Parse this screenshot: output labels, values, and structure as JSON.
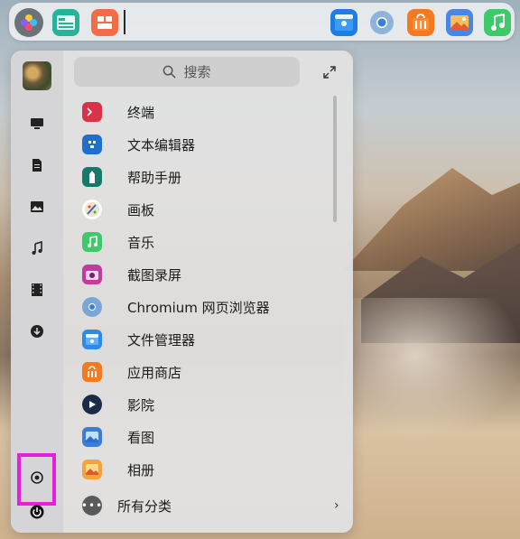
{
  "dock": {
    "items": [
      {
        "name": "launcher-icon"
      },
      {
        "name": "multitask-view-icon"
      },
      {
        "name": "workspace-icon"
      }
    ],
    "tray": [
      {
        "name": "file-manager-icon"
      },
      {
        "name": "chromium-icon"
      },
      {
        "name": "app-store-icon"
      },
      {
        "name": "image-viewer-icon"
      },
      {
        "name": "music-icon"
      }
    ]
  },
  "search": {
    "placeholder": "搜索"
  },
  "sidebar": {
    "categories": [
      "computer-icon",
      "document-icon",
      "picture-icon",
      "music-note-icon",
      "video-icon",
      "download-icon"
    ],
    "settings_icon": "settings-icon",
    "power_icon": "power-icon",
    "highlight_color": "#e81fd8"
  },
  "apps": [
    {
      "label": "终端",
      "icon": "terminal-icon",
      "color": "#d8334a"
    },
    {
      "label": "文本编辑器",
      "icon": "text-editor-icon",
      "color": "#1f6fd1"
    },
    {
      "label": "帮助手册",
      "icon": "manual-icon",
      "color": "#167a6a"
    },
    {
      "label": "画板",
      "icon": "draw-icon",
      "color": "#ffffff"
    },
    {
      "label": "音乐",
      "icon": "music-app-icon",
      "color": "#3fc96a"
    },
    {
      "label": "截图录屏",
      "icon": "screenshot-icon",
      "color": "#c23a9e"
    },
    {
      "label": "Chromium 网页浏览器",
      "icon": "chromium-app-icon",
      "color": "#7aa6d6"
    },
    {
      "label": "文件管理器",
      "icon": "file-manager-app-icon",
      "color": "#2d8be6"
    },
    {
      "label": "应用商店",
      "icon": "app-store-app-icon",
      "color": "#f47a21"
    },
    {
      "label": "影院",
      "icon": "movie-icon",
      "color": "#1c2b4a"
    },
    {
      "label": "看图",
      "icon": "image-viewer-app-icon",
      "color": "#3d7bd9"
    },
    {
      "label": "相册",
      "icon": "album-icon",
      "color": "#f2a33c"
    }
  ],
  "all_categories": {
    "label": "所有分类",
    "chevron": "›"
  }
}
